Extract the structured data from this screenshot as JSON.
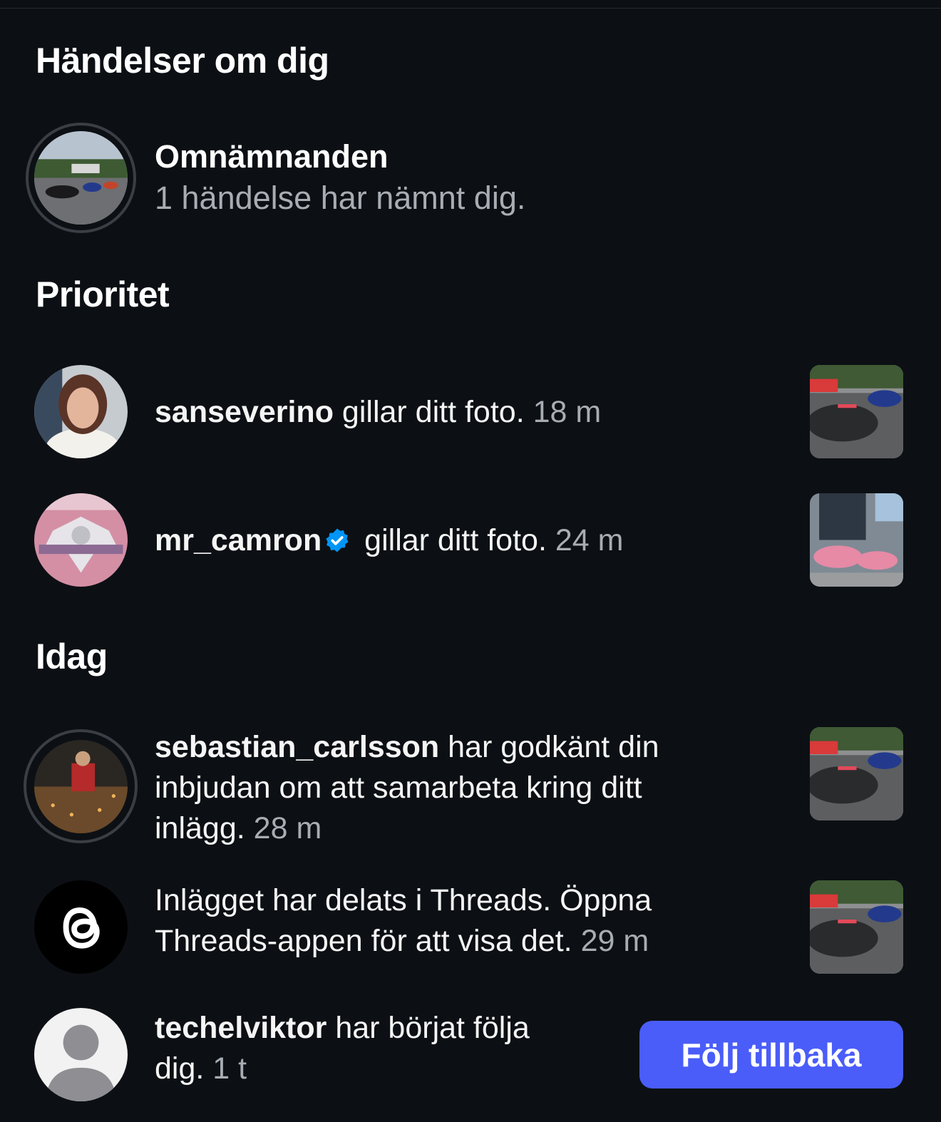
{
  "sections": {
    "events_title": "Händelser om dig",
    "priority_title": "Prioritet",
    "today_title": "Idag"
  },
  "mentions": {
    "title": "Omnämnanden",
    "subtitle": "1 händelse har nämnt dig."
  },
  "priority": [
    {
      "username": "sanseverino",
      "action": "gillar ditt foto.",
      "time": "18 m"
    },
    {
      "username": "mr_camron",
      "action": "gillar ditt foto.",
      "time": "24 m",
      "verified": true
    }
  ],
  "today": [
    {
      "username": "sebastian_carlsson",
      "action_line1": "har godkänt din",
      "action_line2": "inbjudan om att samarbeta kring ditt",
      "action_line3": "inlägg.",
      "time": "28 m"
    },
    {
      "line1": "Inlägget har delats i Threads. Öppna",
      "line2": "Threads-appen för att visa det.",
      "time": "29 m",
      "icon": "threads-icon"
    },
    {
      "username": "techelviktor",
      "action_line1": "har börjat följa",
      "action_line2": "dig.",
      "time": "1 t",
      "button": "Följ tillbaka"
    }
  ],
  "colors": {
    "background": "#0c1014",
    "accent": "#4a5df9",
    "verified": "#0095f6",
    "muted_text": "#a8adb4"
  }
}
